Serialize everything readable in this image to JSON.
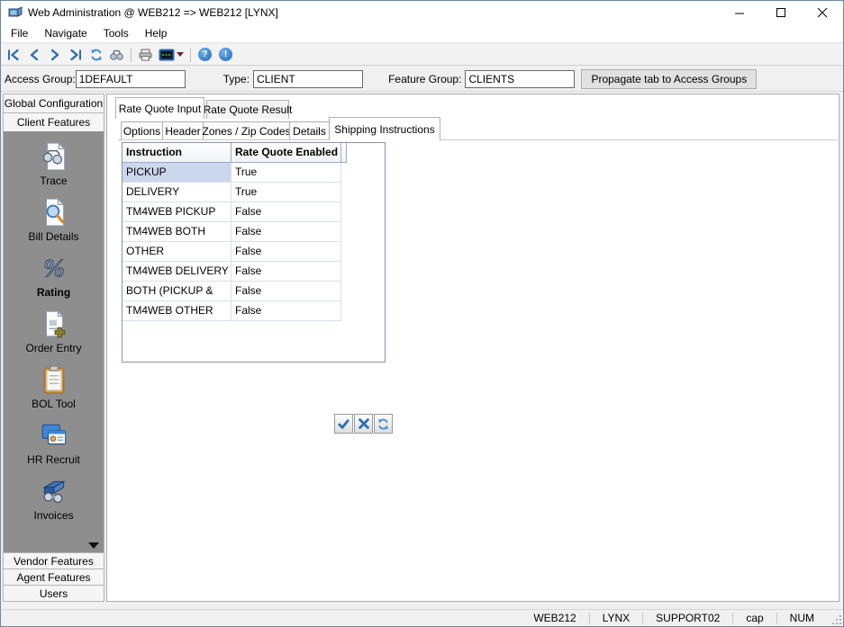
{
  "window": {
    "title": "Web Administration @ WEB212 => WEB212 [LYNX]"
  },
  "menu": {
    "items": [
      "File",
      "Navigate",
      "Tools",
      "Help"
    ]
  },
  "toolbar": {
    "icons": [
      "first-record",
      "previous-record",
      "next-record",
      "last-record",
      "refresh",
      "find-binoculars",
      "print",
      "console-dropdown",
      "help",
      "about"
    ]
  },
  "form": {
    "access_group_label": "Access Group:",
    "access_group_value": "1DEFAULT",
    "type_label": "Type:",
    "type_value": "CLIENT",
    "feature_group_label": "Feature Group:",
    "feature_group_value": "CLIENTS",
    "propagate_button_label": "Propagate tab to Access Groups"
  },
  "sidebar": {
    "top_buttons": [
      "Global Configuration",
      "Client Features"
    ],
    "features": [
      "Trace",
      "Bill Details",
      "Rating",
      "Order Entry",
      "BOL Tool",
      "HR Recruit",
      "Invoices"
    ],
    "selected_feature": "Rating",
    "bottom_buttons": [
      "Vendor Features",
      "Agent Features",
      "Users"
    ]
  },
  "main": {
    "tabs": [
      "Rate Quote Input",
      "Rate Quote Result"
    ],
    "selected_tab": "Rate Quote Input",
    "subtabs": [
      "Options",
      "Header",
      "Zones / Zip Codes",
      "Details",
      "Shipping Instructions"
    ],
    "selected_subtab": "Shipping Instructions"
  },
  "grid": {
    "columns": [
      "Instruction",
      "Rate Quote Enabled"
    ],
    "selected_row": "PICKUP",
    "rows": [
      {
        "instruction": "PICKUP",
        "rate_quote_enabled": "True"
      },
      {
        "instruction": "DELIVERY",
        "rate_quote_enabled": "True"
      },
      {
        "instruction": "TM4WEB PICKUP",
        "rate_quote_enabled": "False"
      },
      {
        "instruction": "TM4WEB BOTH",
        "rate_quote_enabled": "False"
      },
      {
        "instruction": "OTHER",
        "rate_quote_enabled": "False"
      },
      {
        "instruction": "TM4WEB DELIVERY",
        "rate_quote_enabled": "False"
      },
      {
        "instruction": "BOTH (PICKUP &",
        "rate_quote_enabled": "False"
      },
      {
        "instruction": "TM4WEB OTHER",
        "rate_quote_enabled": "False"
      }
    ]
  },
  "statusbar": {
    "items": [
      "WEB212",
      "LYNX",
      "SUPPORT02",
      "cap",
      "NUM"
    ]
  },
  "colors": {
    "accent_blue": "#2e6db5",
    "selection_blue": "#ccd7ee",
    "grid_border": "#8494a9",
    "sidebar_panel_gray": "#8e8e8e"
  }
}
